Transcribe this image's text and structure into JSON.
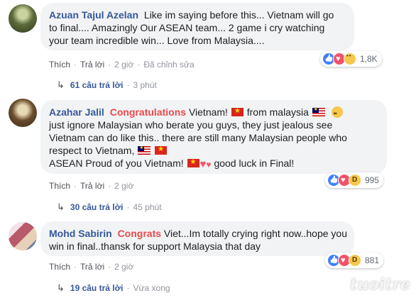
{
  "comments": [
    {
      "author": "Azuan Tajul Azelan",
      "text": "Like im saying before this... Vietnam will go to final.... Amazingly Our ASEAN team... 2 game i cry watching your team incredible win... Love from Malaysia....",
      "reaction_icons": [
        "like-icon",
        "love-icon",
        "sad-icon"
      ],
      "reaction_count": "1,8K",
      "actions": {
        "like": "Thích",
        "reply": "Trả lời",
        "time": "2 giờ",
        "edited": "Đã chỉnh sửa"
      },
      "replies": {
        "count": "61 câu trả lời",
        "time": "3 phút"
      }
    },
    {
      "author": "Azahar Jalil",
      "highlight": "Congratulations",
      "line1": "Vietnam!",
      "line1b": "from malaysia",
      "line2": "just ignore Malaysian who berate you guys, they just jealous see",
      "line3": "Vietnam can do like this.. there are still many Malaysian people who",
      "line4": "respect to Vietnam,",
      "line5a": "ASEAN Proud of you Vietnam!",
      "line5b": "good luck in Final!",
      "reaction_icons": [
        "like-icon",
        "love-icon",
        "haha-icon"
      ],
      "reaction_count": "995",
      "actions": {
        "like": "Thích",
        "reply": "Trả lời",
        "time": "2 giờ"
      },
      "replies": {
        "count": "30 câu trả lời",
        "time": "45 phút"
      }
    },
    {
      "author": "Mohd Sabirin",
      "highlight": "Congrats",
      "line1": "Viet...Im totally crying right now..hope you",
      "line2": "win in final..thansk for support Malaysia that day",
      "reaction_icons": [
        "like-icon",
        "love-icon",
        "haha-icon"
      ],
      "reaction_count": "881",
      "actions": {
        "like": "Thích",
        "reply": "Trả lời",
        "time": "2 giờ"
      },
      "replies": {
        "count": "19 câu trả lời",
        "time": "Vừa xong"
      }
    }
  ],
  "watermark": "tuoitre",
  "colors": {
    "author": "#365899",
    "highlight": "#e8494b",
    "bubble": "#f2f3f5"
  }
}
